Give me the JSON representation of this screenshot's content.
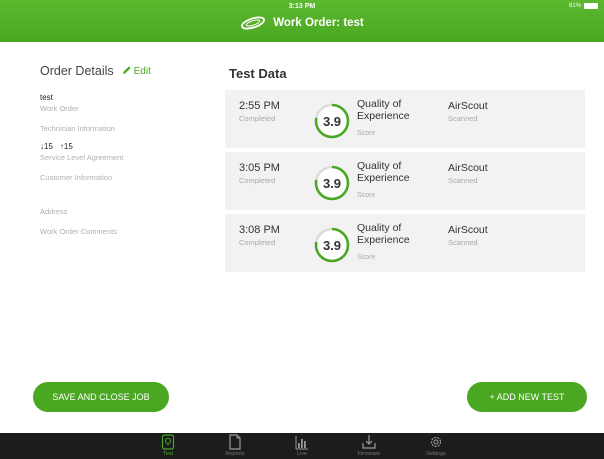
{
  "status_bar": {
    "time": "3:13 PM",
    "battery": "81%"
  },
  "header": {
    "title": "Work Order: test"
  },
  "order_details": {
    "title": "Order Details",
    "edit_label": "Edit",
    "work_order_value": "test",
    "work_order_label": "Work Order",
    "technician_label": "Technician Information",
    "sla_down": "↓15",
    "sla_up": "↑15",
    "sla_label": "Service Level Agreement",
    "customer_label": "Customer Information",
    "address_label": "Address",
    "comments_label": "Work Order Comments"
  },
  "test_data": {
    "title": "Test Data",
    "tests": [
      {
        "time": "2:55 PM",
        "status": "Completed",
        "score": "3.9",
        "quality": "Quality of Experience",
        "score_label": "Score",
        "device": "AirScout",
        "device_status": "Scanned",
        "fraction": 0.78
      },
      {
        "time": "3:05 PM",
        "status": "Completed",
        "score": "3.9",
        "quality": "Quality of Experience",
        "score_label": "Score",
        "device": "AirScout",
        "device_status": "Scanned",
        "fraction": 0.78
      },
      {
        "time": "3:08 PM",
        "status": "Completed",
        "score": "3.9",
        "quality": "Quality of Experience",
        "score_label": "Score",
        "device": "AirScout",
        "device_status": "Scanned",
        "fraction": 0.78
      }
    ]
  },
  "buttons": {
    "save_close": "SAVE AND CLOSE JOB",
    "add_test": "+ ADD NEW TEST"
  },
  "tabs": [
    {
      "label": "Test",
      "icon": "test-icon",
      "active": true
    },
    {
      "label": "Reports",
      "icon": "reports-icon",
      "active": false
    },
    {
      "label": "Live",
      "icon": "live-icon",
      "active": false
    },
    {
      "label": "Firmware",
      "icon": "firmware-icon",
      "active": false
    },
    {
      "label": "Settings",
      "icon": "settings-icon",
      "active": false
    }
  ],
  "colors": {
    "accent": "#4aa722",
    "tabbar": "#1c1c1c",
    "card": "#f2f2f2"
  }
}
